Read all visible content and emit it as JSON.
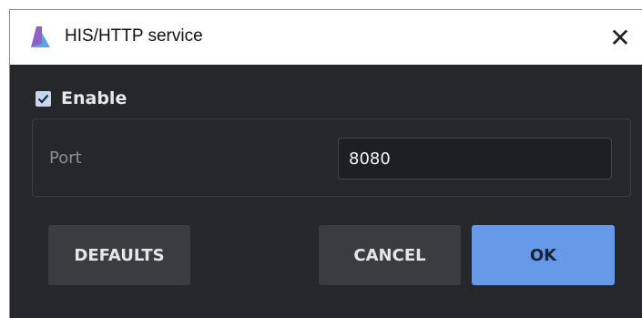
{
  "window": {
    "title": "HIS/HTTP service",
    "close_glyph": "✕",
    "icon": "app-triangle-icon"
  },
  "enable": {
    "label": "Enable",
    "checked": true
  },
  "port": {
    "label": "Port",
    "value": "8080"
  },
  "buttons": {
    "defaults": "DEFAULTS",
    "cancel": "CANCEL",
    "ok": "OK"
  },
  "colors": {
    "background": "#26272a",
    "accent": "#6699e8",
    "button": "#3b3c40",
    "icon_purple": "#8e5fc8",
    "icon_blue": "#5aa4e6"
  }
}
